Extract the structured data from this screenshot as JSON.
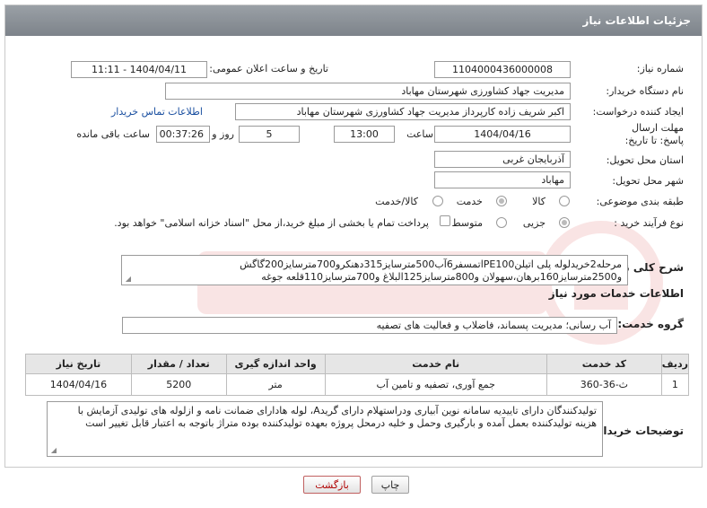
{
  "header": {
    "title": "جزئیات اطلاعات نیاز"
  },
  "fields": {
    "need_number": {
      "label": "شماره نیاز:",
      "value": "1104000436000008"
    },
    "announce_datetime": {
      "label": "تاریخ و ساعت اعلان عمومی:",
      "value": "1404/04/11 - 11:11"
    },
    "buyer_org": {
      "label": "نام دستگاه خریدار:",
      "value": "مدیریت جهاد کشاورزی شهرستان مهاباد"
    },
    "creator": {
      "label": "ایجاد کننده درخواست:",
      "value": "اکبر شریف زاده کارپرداز مدیریت جهاد کشاورزی شهرستان مهاباد",
      "contact_link": "اطلاعات تماس خریدار"
    },
    "deadline": {
      "label": "مهلت ارسال پاسخ: تا تاریخ:",
      "date": "1404/04/16",
      "time_label": "ساعت",
      "time": "13:00",
      "days": "5",
      "days_label": "روز و",
      "remaining": "00:37:26",
      "remaining_label": "ساعت باقی مانده"
    },
    "province": {
      "label": "استان محل تحویل:",
      "value": "آذربایجان غربی"
    },
    "city": {
      "label": "شهر محل تحویل:",
      "value": "مهاباد"
    },
    "category": {
      "label": "طبقه بندی موضوعی:",
      "options": [
        "کالا",
        "خدمت",
        "کالا/خدمت"
      ],
      "selected": "خدمت"
    },
    "process": {
      "label": "نوع فرآیند خرید :",
      "options": [
        "جزیی",
        "متوسط"
      ],
      "selected": "جزیی",
      "payment_note": "پرداخت تمام یا بخشی از مبلغ خرید،از محل \"اسناد خزانه اسلامی\" خواهد بود."
    }
  },
  "description": {
    "label": "شرح کلی نیاز:",
    "text": "مرحله2خریدلوله پلی اتیلنPE100اتمسفر6آب500مترسایز315دهنکرو700مترسایز200گاگش و2500مترسایز160برهان،سهولان و800مترسایز125البلاغ و700مترسایز110قلعه جوغه"
  },
  "services_section": {
    "title": "اطلاعات خدمات مورد نیاز",
    "group_label": "گروه خدمت:",
    "group_value": "آب رسانی؛ مدیریت پسماند، فاضلاب و فعالیت های تصفیه"
  },
  "table": {
    "headers": [
      "ردیف",
      "کد خدمت",
      "نام خدمت",
      "واحد اندازه گیری",
      "تعداد / مقدار",
      "تاریخ نیاز"
    ],
    "rows": [
      [
        "1",
        "ث-36-360",
        "جمع آوری، تصفیه و تامین آب",
        "متر",
        "5200",
        "1404/04/16"
      ]
    ]
  },
  "buyer_notes": {
    "label": "توضیحات خریدار:",
    "text": "تولیدکنندگان دارای تاییدیه سامانه نوین آبیاری ودراستهلام دارای گریدA، لوله هادارای ضمانت نامه و ازلوله های تولیدی آزمایش با هزینه تولیدکننده بعمل آمده و بارگیری وحمل و خلیه درمحل پروژه بعهده تولیدکننده بوده متراژ باتوجه به اعتبار قابل تغییر است"
  },
  "buttons": {
    "print": "چاپ",
    "back": "بازگشت"
  },
  "colors": {
    "header_bg": "#8a9096",
    "link": "#1a4fa0",
    "back_text": "#b00000"
  }
}
